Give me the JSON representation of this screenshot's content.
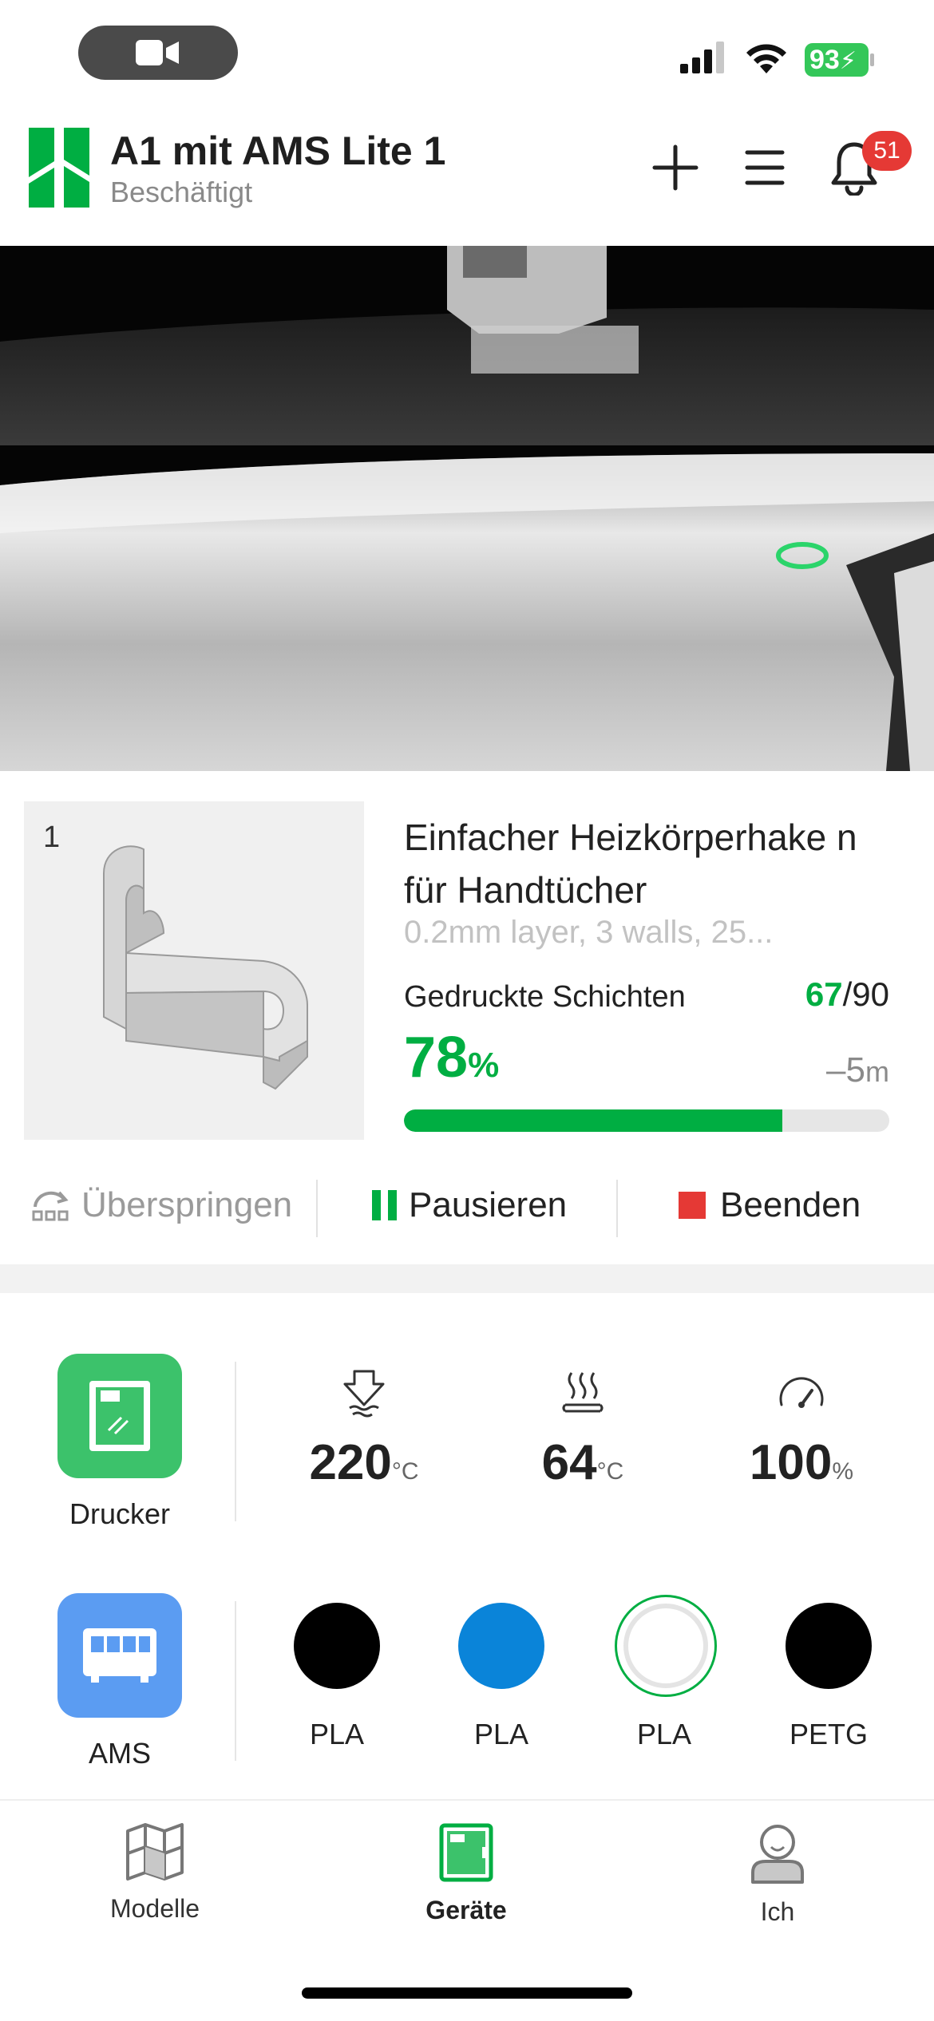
{
  "status_bar": {
    "battery": "93"
  },
  "header": {
    "title": "A1 mit AMS Lite 1",
    "subtitle": "Beschäftigt",
    "notification_count": "51"
  },
  "job": {
    "plate_number": "1",
    "name": "Einfacher Heizkörperhake n für Handtücher",
    "params": "0.2mm layer, 3 walls, 25...",
    "layers_label": "Gedruckte Schichten",
    "layers_current": "67",
    "layers_total": "/90",
    "progress_value": "78",
    "progress_unit": "%",
    "progress_fraction": 0.78,
    "remaining": "–5",
    "remaining_unit": "m"
  },
  "actions": {
    "skip": "Überspringen",
    "pause": "Pausieren",
    "stop": "Beenden"
  },
  "printer": {
    "label": "Drucker",
    "nozzle_temp": "220",
    "nozzle_unit": "°C",
    "bed_temp": "64",
    "bed_unit": "°C",
    "speed": "100",
    "speed_unit": "%"
  },
  "ams": {
    "label": "AMS",
    "slots": [
      {
        "material": "PLA",
        "color": "#000000"
      },
      {
        "material": "PLA",
        "color": "#0a84d9"
      },
      {
        "material": "PLA",
        "color": "#ffffff"
      },
      {
        "material": "PETG",
        "color": "#000000"
      }
    ]
  },
  "nav": {
    "models": "Modelle",
    "devices": "Geräte",
    "me": "Ich"
  },
  "colors": {
    "accent": "#00ae42",
    "ams_icon": "#5b9cf2",
    "printer_icon": "#3cc26b",
    "stop": "#e53935"
  }
}
